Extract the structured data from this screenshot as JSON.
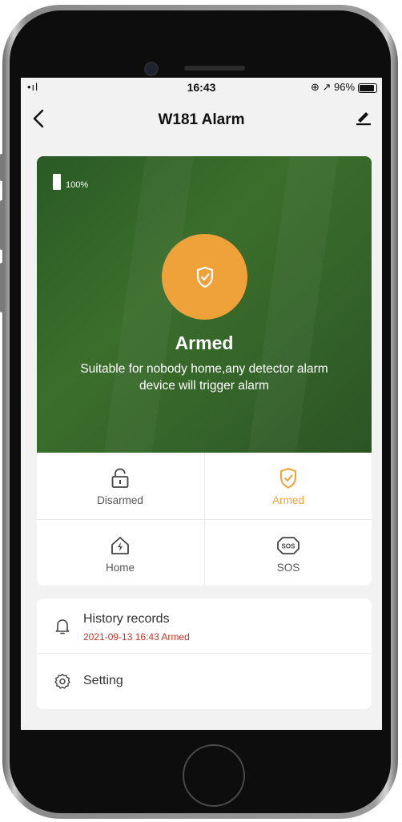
{
  "status_bar": {
    "signal": "•ıl",
    "time": "16:43",
    "indicators": "⊕ ↗ 96%"
  },
  "nav": {
    "back_icon": "chevron-left-icon",
    "title": "W181 Alarm",
    "edit_icon": "pencil-icon"
  },
  "hero": {
    "battery_level": "100%",
    "state_icon": "shield-check-icon",
    "state": "Armed",
    "description": "Suitable for nobody home,any detector alarm device will trigger alarm",
    "background_color": "#33652a",
    "accent_color": "#f0a23a"
  },
  "modes": [
    {
      "label": "Disarmed",
      "icon": "unlocked-padlock-icon",
      "active": false
    },
    {
      "label": "Armed",
      "icon": "shield-check-icon",
      "active": true
    },
    {
      "label": "Home",
      "icon": "home-bolt-icon",
      "active": false
    },
    {
      "label": "SOS",
      "icon": "sos-icon",
      "active": false
    }
  ],
  "menu": {
    "history": {
      "title": "History records",
      "latest": "2021-09-13 16:43 Armed",
      "icon": "bell-icon"
    },
    "setting": {
      "title": "Setting",
      "icon": "gear-icon"
    }
  }
}
